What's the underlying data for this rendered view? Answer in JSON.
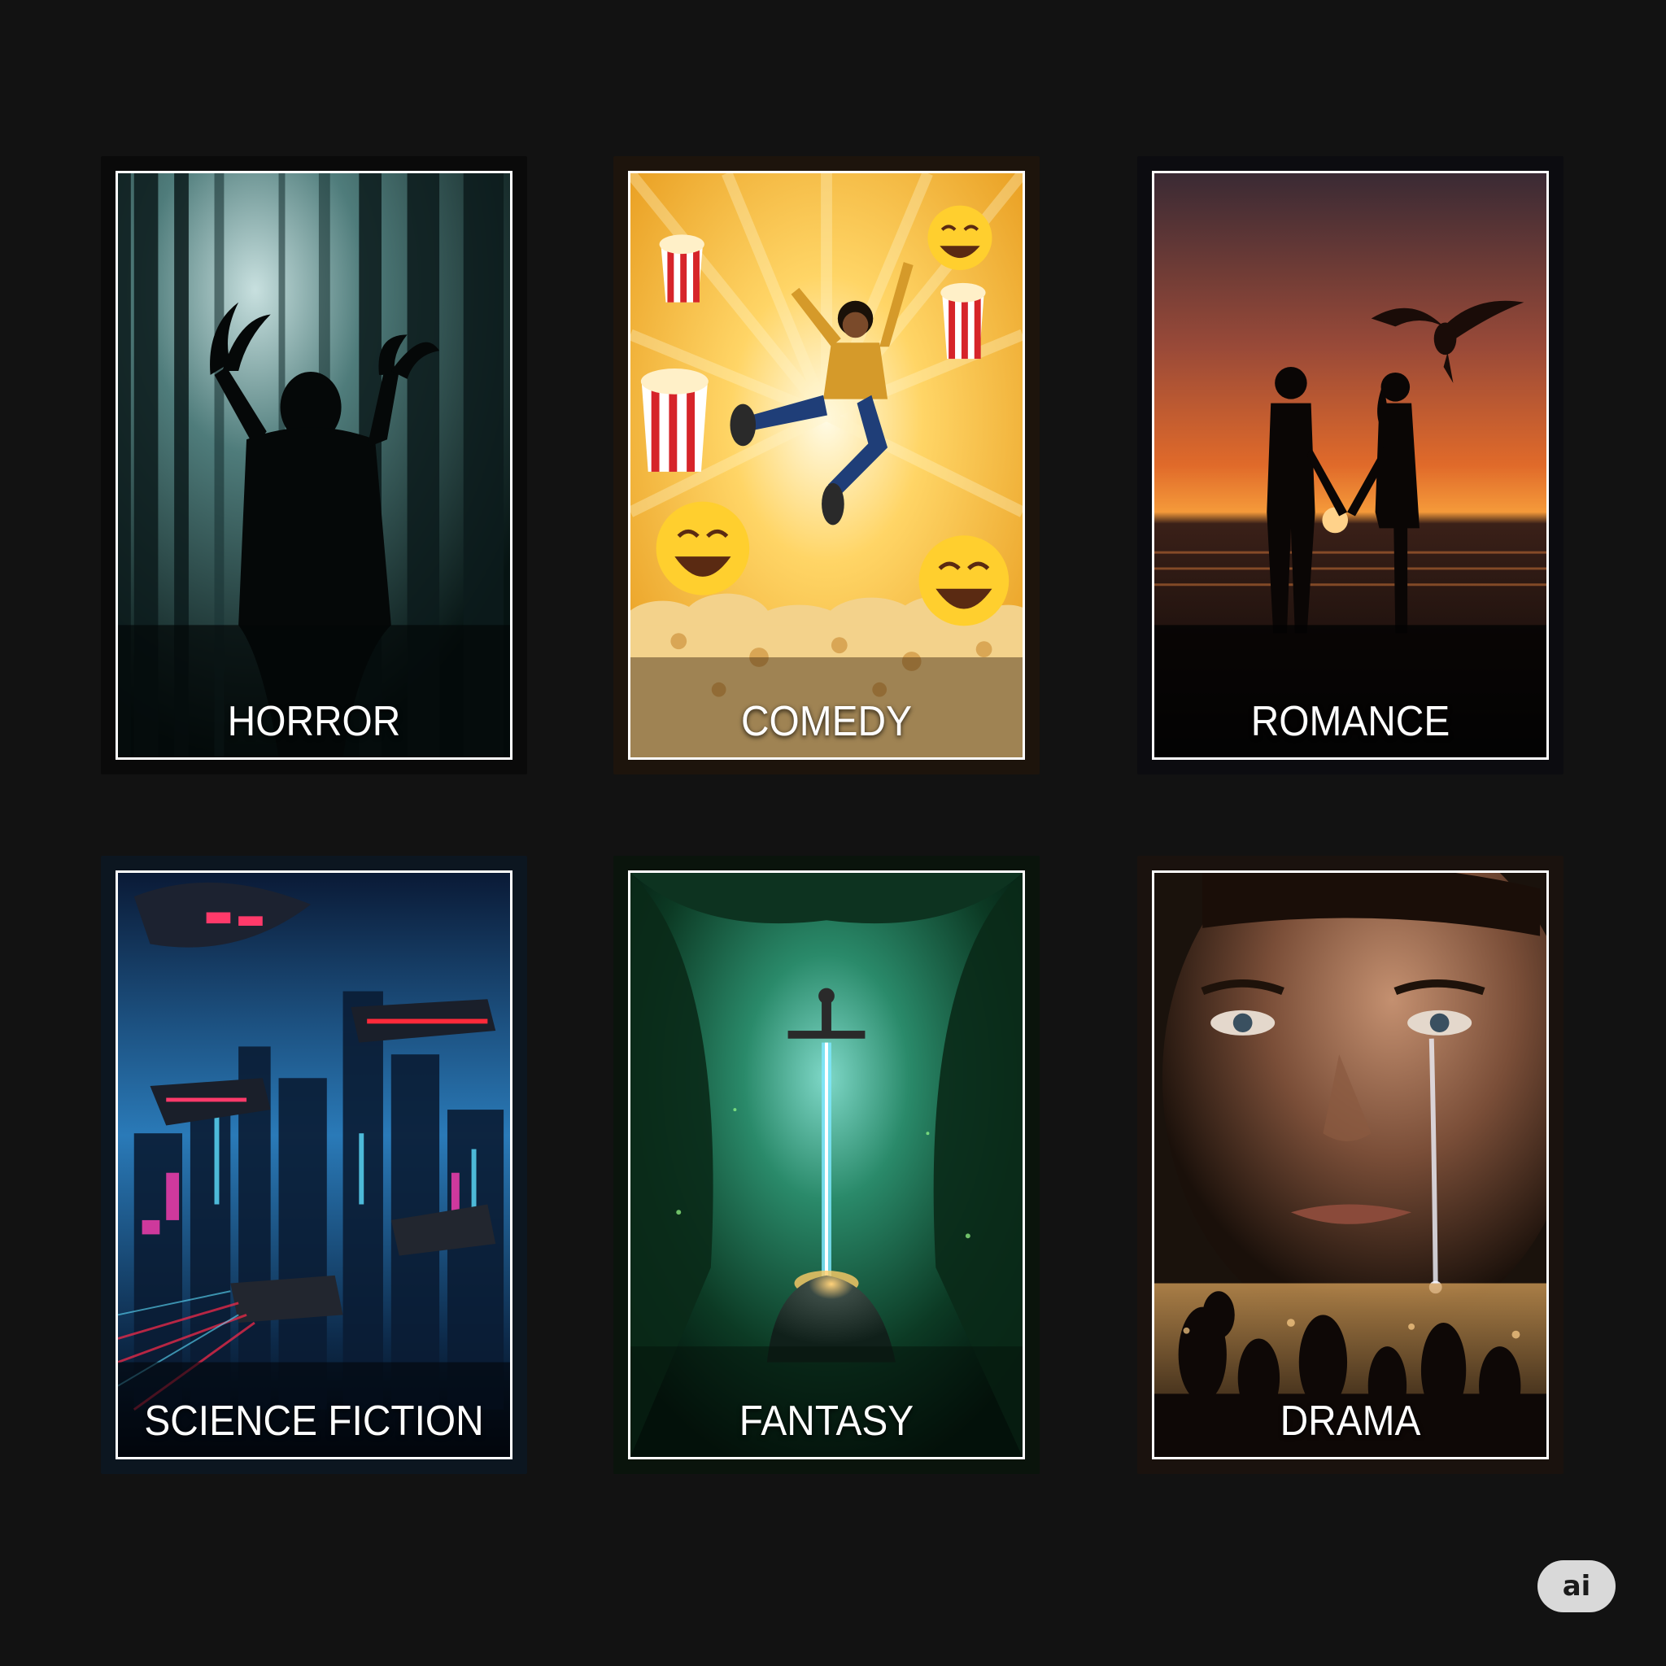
{
  "genres": [
    {
      "key": "horror",
      "label": "HORROR"
    },
    {
      "key": "comedy",
      "label": "COMEDY"
    },
    {
      "key": "romance",
      "label": "ROMANCE"
    },
    {
      "key": "scifi",
      "label": "SCIENCE FICTION"
    },
    {
      "key": "fantasy",
      "label": "FANTASY"
    },
    {
      "key": "drama",
      "label": "DRAMA"
    }
  ],
  "badge": {
    "text": "ai"
  },
  "colors": {
    "background": "#121212",
    "card_frame": "#ffffff",
    "horror_bg": "#0f2a2c",
    "comedy_bg": "#f6b938",
    "romance_bg": "#e36a2a",
    "scifi_bg": "#0a2c57",
    "fantasy_bg": "#0e3a2c",
    "drama_bg": "#3b2a20"
  },
  "icons": [
    "shadow-monster-icon",
    "popcorn-icon",
    "laughing-emoji-icon",
    "dragon-icon",
    "spaceship-icon",
    "sword-icon",
    "tear-icon"
  ]
}
